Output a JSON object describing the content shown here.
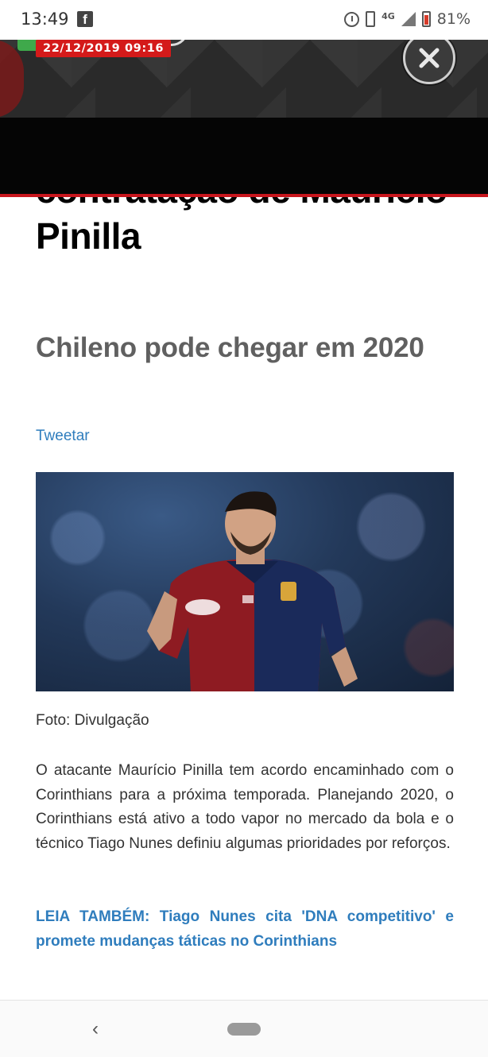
{
  "status_bar": {
    "time": "13:49",
    "app_icon": "facebook-icon",
    "network": "4G",
    "battery_pct": "81%",
    "icons": [
      "alarm-icon",
      "vibrate-icon",
      "signal-icon",
      "battery-icon"
    ]
  },
  "article": {
    "date": "22/12/2019 09:16",
    "headline": "Corinthians encaminha contratação de Maurício Pinilla",
    "subtitle": "Chileno pode chegar em 2020",
    "tweet_label": "Tweetar",
    "photo_caption": "Foto: Divulgação",
    "body": "O atacante Maurício Pinilla tem acordo encaminhado com o Corinthians para a próxima temporada. Planejando 2020, o Corinthians está ativo a todo vapor no mercado da bola e o técnico Tiago Nunes definiu algumas prioridades por reforços.",
    "related_link": "LEIA TAMBÉM: Tiago Nunes cita 'DNA competitivo' e promete mudanças táticas no Corinthians"
  },
  "nav": {
    "back_glyph": "‹"
  },
  "colors": {
    "date_badge": "#d41a1a",
    "link": "#2f7dbd",
    "banner_accent": "#c8161d"
  }
}
